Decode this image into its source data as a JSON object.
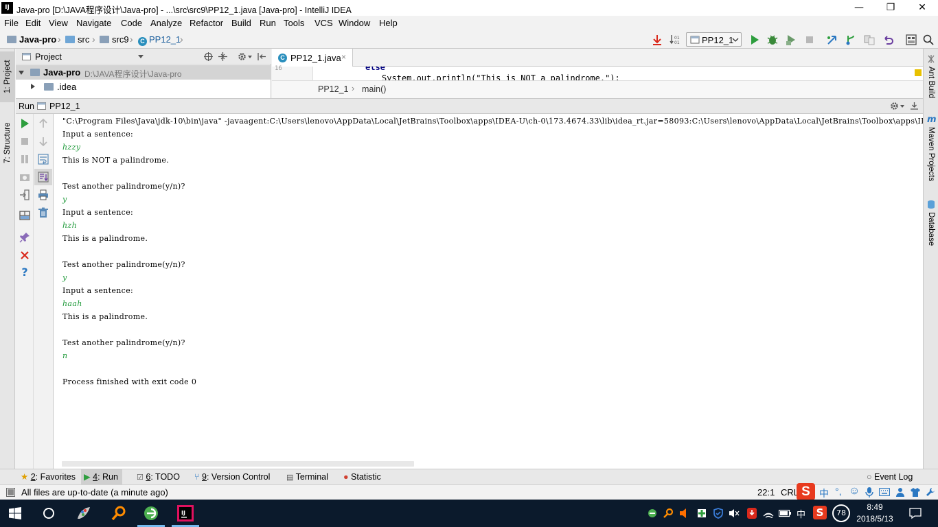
{
  "window": {
    "title": "Java-pro [D:\\JAVA程序设计\\Java-pro] - ...\\src\\src9\\PP12_1.java [Java-pro] - IntelliJ IDEA",
    "logo_text": "IJ",
    "minimize": "—",
    "maximize": "❐",
    "close": "✕"
  },
  "menu": [
    {
      "label": "File"
    },
    {
      "label": "Edit"
    },
    {
      "label": "View"
    },
    {
      "label": "Navigate"
    },
    {
      "label": "Code"
    },
    {
      "label": "Analyze"
    },
    {
      "label": "Refactor"
    },
    {
      "label": "Build"
    },
    {
      "label": "Run"
    },
    {
      "label": "Tools"
    },
    {
      "label": "VCS"
    },
    {
      "label": "Window"
    },
    {
      "label": "Help"
    }
  ],
  "breadcrumb": {
    "project": "Java-pro",
    "src": "src",
    "src9": "src9",
    "file": "PP12_1"
  },
  "run_config": {
    "label": "PP12_1"
  },
  "left_tabs": {
    "project": "1: Project",
    "structure": "7: Structure"
  },
  "right_tabs": {
    "ant": "Ant Build",
    "maven": "Maven Projects",
    "database": "Database"
  },
  "project_panel": {
    "header": "Project",
    "root_label": "Java-pro",
    "root_path": "D:\\JAVA程序设计\\Java-pro",
    "child_label": ".idea"
  },
  "editor": {
    "tab_label": "PP12_1.java",
    "line_numbers": "16",
    "code_line": "else",
    "code_line2": "System.out.println(\"This is NOT a palindrome.\");",
    "crumb_class": "PP12_1",
    "crumb_method": "main()"
  },
  "run_panel": {
    "label": "Run",
    "config": "PP12_1",
    "lines": [
      {
        "text": "\"C:\\Program Files\\Java\\jdk-10\\bin\\java\" -javaagent:C:\\Users\\lenovo\\AppData\\Local\\JetBrains\\Toolbox\\apps\\IDEA-U\\ch-0\\173.4674.33\\lib\\idea_rt.jar=58093:C:\\Users\\lenovo\\AppData\\Local\\JetBrains\\Toolbox\\apps\\IDEA-U",
        "kind": "cmd"
      },
      {
        "text": "Input a sentence:",
        "kind": "out"
      },
      {
        "text": "hzzy",
        "kind": "inp"
      },
      {
        "text": "This is NOT a palindrome.",
        "kind": "out"
      },
      {
        "text": "",
        "kind": "out"
      },
      {
        "text": "Test another palindrome(y/n)?",
        "kind": "out"
      },
      {
        "text": "y",
        "kind": "inp"
      },
      {
        "text": "Input a sentence:",
        "kind": "out"
      },
      {
        "text": "hzh",
        "kind": "inp"
      },
      {
        "text": "This is a palindrome.",
        "kind": "out"
      },
      {
        "text": "",
        "kind": "out"
      },
      {
        "text": "Test another palindrome(y/n)?",
        "kind": "out"
      },
      {
        "text": "y",
        "kind": "inp"
      },
      {
        "text": "Input a sentence:",
        "kind": "out"
      },
      {
        "text": "haah",
        "kind": "inp"
      },
      {
        "text": "This is a palindrome.",
        "kind": "out"
      },
      {
        "text": "",
        "kind": "out"
      },
      {
        "text": "Test another palindrome(y/n)?",
        "kind": "out"
      },
      {
        "text": "n",
        "kind": "inp"
      },
      {
        "text": "",
        "kind": "out"
      },
      {
        "text": "Process finished with exit code 0",
        "kind": "out"
      }
    ]
  },
  "bottom_tabs": {
    "favorites_num": "2",
    "favorites": ": Favorites",
    "run_num": "4",
    "run": ": Run",
    "todo_num": "6",
    "todo": ": TODO",
    "vc_num": "9",
    "vc": ": Version Control",
    "terminal": "Terminal",
    "statistic": "Statistic",
    "event_log": "Event Log"
  },
  "status": {
    "message": "All files are up-to-date (a minute ago)",
    "position": "22:1",
    "line_sep": "CRL",
    "ime_char": "中"
  },
  "taskbar": {
    "time": "8:49",
    "date": "2018/5/13",
    "battery": "78",
    "ime": "中"
  },
  "colors": {
    "accent": "#2a8fbd",
    "run_green": "#2e9e3e",
    "input_green": "#1f9a3a",
    "taskbar_bg": "#0b1a2c",
    "error_red": "#d9291c"
  }
}
